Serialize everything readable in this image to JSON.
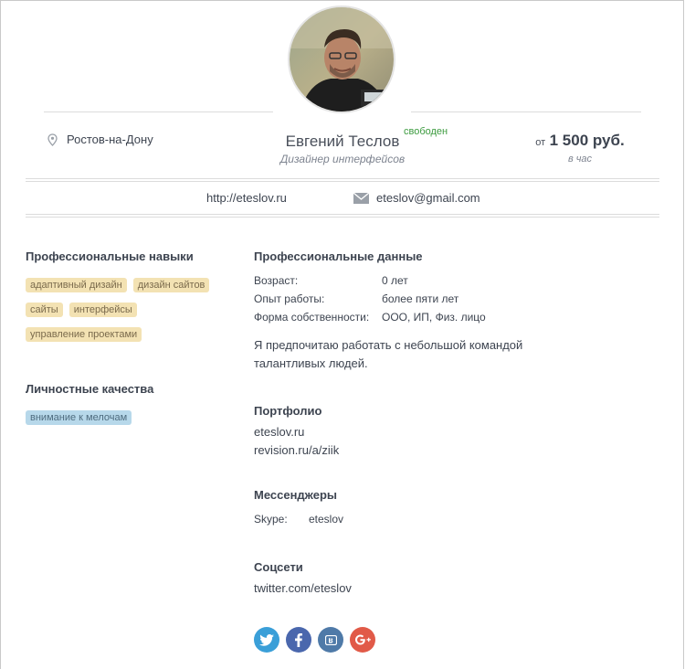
{
  "profile": {
    "name": "Евгений Теслов",
    "status": "свободен",
    "role": "Дизайнер интерфейсов",
    "location": "Ростов-на-Дону",
    "price_prefix": "от",
    "price_amount": "1 500 руб.",
    "price_unit": "в час",
    "website": "http://eteslov.ru",
    "email": "eteslov@gmail.com"
  },
  "skills": {
    "title": "Профессиональные навыки",
    "tags": [
      "адаптивный дизайн",
      "дизайн сайтов",
      "сайты",
      "интерфейсы",
      "управление проектами"
    ]
  },
  "personal": {
    "title": "Личностные качества",
    "tags": [
      "внимание к мелочам"
    ]
  },
  "professional": {
    "title": "Профессиональные данные",
    "rows": [
      {
        "key": "Возраст:",
        "value": "0 лет"
      },
      {
        "key": "Опыт работы:",
        "value": "более пяти лет"
      },
      {
        "key": "Форма собственности:",
        "value": "ООО, ИП, Физ. лицо"
      }
    ],
    "about": "Я предпочитаю работать с небольшой командой талантливых людей."
  },
  "portfolio": {
    "title": "Портфолио",
    "links": [
      "eteslov.ru",
      "revision.ru/a/ziik"
    ]
  },
  "messengers": {
    "title": "Мессенджеры",
    "skype_label": "Skype:",
    "skype_value": "eteslov"
  },
  "social": {
    "title": "Соцсети",
    "link": "twitter.com/eteslov",
    "icons": [
      "twitter-icon",
      "facebook-icon",
      "vk-icon",
      "google-plus-icon"
    ]
  },
  "colors": {
    "skill_tag_bg": "#f3e2b3",
    "personal_tag_bg": "#b7d8ea",
    "status_green": "#3c9b3f",
    "twitter": "#3a9fd8",
    "facebook": "#4a67ad",
    "vk": "#4f7aa8",
    "google_plus": "#e15a48"
  }
}
